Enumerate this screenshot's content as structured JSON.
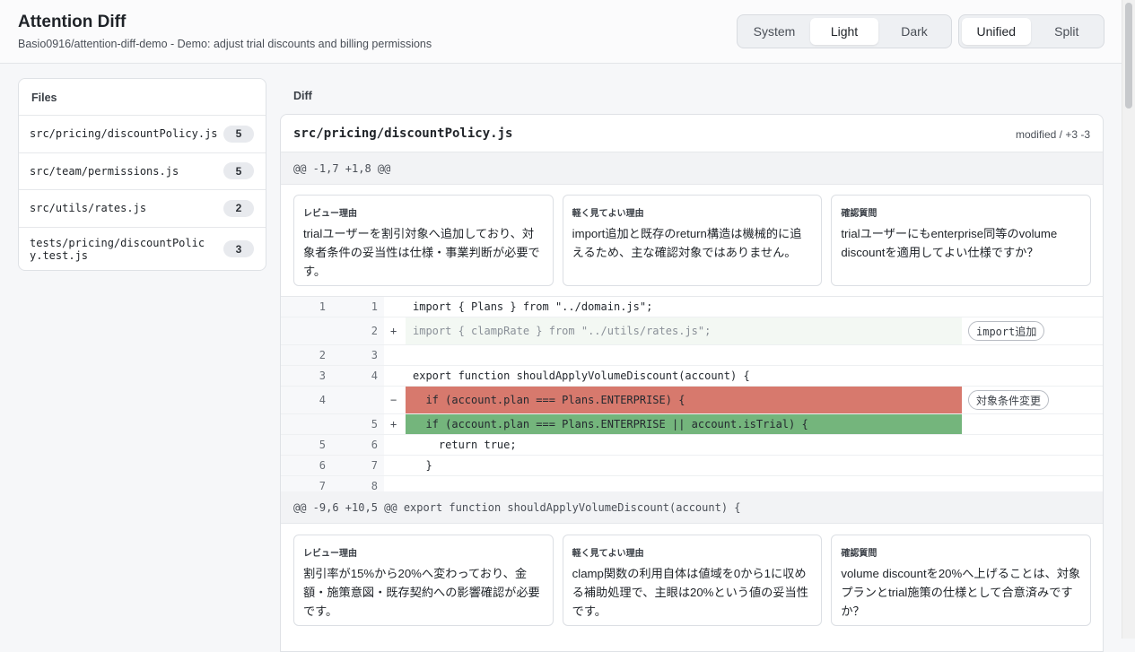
{
  "header": {
    "title": "Attention Diff",
    "subtitle": "Basio0916/attention-diff-demo - Demo: adjust trial discounts and billing permissions",
    "theme_options": [
      "System",
      "Light",
      "Dark"
    ],
    "theme_selected": "Light",
    "view_options": [
      "Unified",
      "Split"
    ],
    "view_selected": "Unified"
  },
  "files": {
    "heading": "Files",
    "items": [
      {
        "name": "src/pricing/discountPolicy.js",
        "count": "5"
      },
      {
        "name": "src/team/permissions.js",
        "count": "5"
      },
      {
        "name": "src/utils/rates.js",
        "count": "2"
      },
      {
        "name": "tests/pricing/discountPolicy.test.js",
        "count": "3"
      }
    ]
  },
  "diff": {
    "heading": "Diff",
    "file_name": "src/pricing/discountPolicy.js",
    "file_status": "modified / +3 -3",
    "hunks": [
      {
        "header": "@@ -1,7 +1,8 @@",
        "notes": [
          {
            "title": "レビュー理由",
            "body": "trialユーザーを割引対象へ追加しており、対象者条件の妥当性は仕様・事業判断が必要です。"
          },
          {
            "title": "軽く見てよい理由",
            "body": "import追加と既存のreturn構造は機械的に追えるため、主な確認対象ではありません。"
          },
          {
            "title": "確認質問",
            "body": "trialユーザーにもenterprise同等のvolume discountを適用してよい仕様ですか？"
          }
        ],
        "tags": [
          "import追加",
          "対象条件変更"
        ],
        "lines": [
          {
            "old": "1",
            "new": "1",
            "sign": "",
            "text": "import { Plans } from \"../domain.js\";"
          },
          {
            "old": "",
            "new": "2",
            "sign": "+",
            "text": "import { clampRate } from \"../utils/rates.js\";"
          },
          {
            "old": "2",
            "new": "3",
            "sign": "",
            "text": ""
          },
          {
            "old": "3",
            "new": "4",
            "sign": "",
            "text": "export function shouldApplyVolumeDiscount(account) {"
          },
          {
            "old": "4",
            "new": "",
            "sign": "−",
            "text": "  if (account.plan === Plans.ENTERPRISE) {"
          },
          {
            "old": "",
            "new": "5",
            "sign": "+",
            "text": "  if (account.plan === Plans.ENTERPRISE || account.isTrial) {"
          },
          {
            "old": "5",
            "new": "6",
            "sign": "",
            "text": "    return true;"
          },
          {
            "old": "6",
            "new": "7",
            "sign": "",
            "text": "  }"
          },
          {
            "old": "7",
            "new": "8",
            "sign": "",
            "text": ""
          }
        ]
      },
      {
        "header": "@@ -9,6 +10,5 @@ export function shouldApplyVolumeDiscount(account) {",
        "notes": [
          {
            "title": "レビュー理由",
            "body": "割引率が15%から20%へ変わっており、金額・施策意図・既存契約への影響確認が必要です。"
          },
          {
            "title": "軽く見てよい理由",
            "body": "clamp関数の利用自体は値域を0から1に収める補助処理で、主眼は20%という値の妥当性です。"
          },
          {
            "title": "確認質問",
            "body": "volume discountを20%へ上げることは、対象プランとtrial施策の仕様として合意済みですか？"
          }
        ]
      }
    ]
  }
}
